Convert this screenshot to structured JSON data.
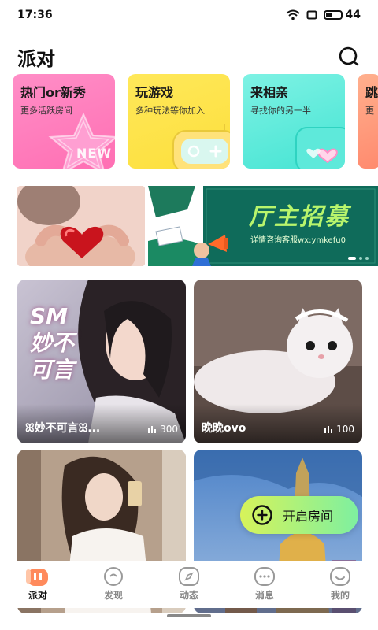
{
  "status_bar": {
    "time": "17:36",
    "battery": "44"
  },
  "header": {
    "title": "派对"
  },
  "categories": [
    {
      "title": "热门or新秀",
      "subtitle": "更多活跃房间",
      "badge": "NEW"
    },
    {
      "title": "玩游戏",
      "subtitle": "多种玩法等你加入"
    },
    {
      "title": "来相亲",
      "subtitle": "寻找你的另一半"
    },
    {
      "title": "跳",
      "subtitle": "更"
    }
  ],
  "banner": {
    "headline": "厅主招募",
    "caption": "详情咨询客服wx:ymkefu0"
  },
  "rooms": [
    {
      "name": "ꕤ妙不可言ꕤ...",
      "count": "300",
      "art_text": "SM 妙不可言"
    },
    {
      "name": "晚晚ovo",
      "count": "100"
    },
    {
      "name": "",
      "count": ""
    },
    {
      "name": "",
      "count": ""
    }
  ],
  "fab": {
    "label": "开启房间"
  },
  "nav": [
    {
      "label": "派对",
      "icon": "party-icon",
      "active": true
    },
    {
      "label": "发现",
      "icon": "discover-icon"
    },
    {
      "label": "动态",
      "icon": "compass-icon"
    },
    {
      "label": "消息",
      "icon": "message-icon"
    },
    {
      "label": "我的",
      "icon": "profile-icon"
    }
  ],
  "colors": {
    "accent": "#ff7a59",
    "fab_start": "#d7f35a",
    "fab_end": "#7ef0a0",
    "banner_green": "#0f6b5a"
  }
}
